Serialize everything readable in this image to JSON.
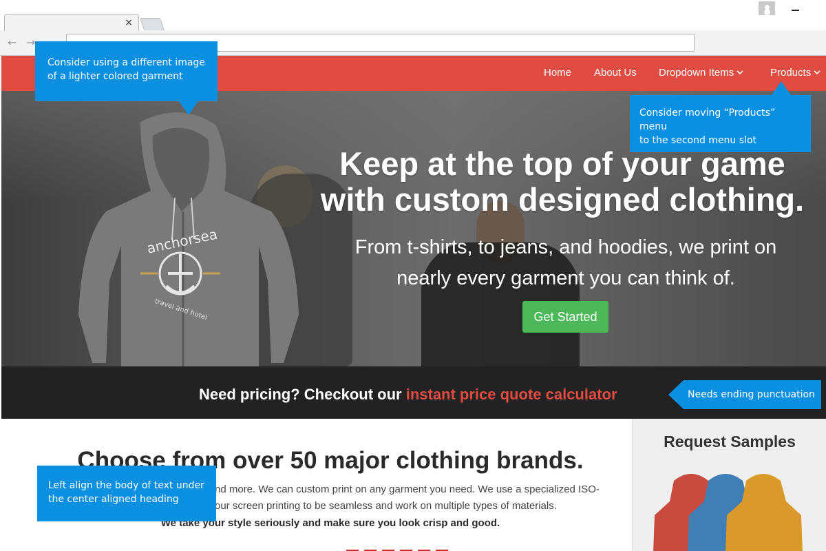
{
  "browser": {
    "tab_close": "×",
    "back_arrow": "←",
    "forward_arrow": "→",
    "icons": [
      "close-icon",
      "back-icon",
      "forward-icon",
      "user-icon",
      "minimize-icon"
    ]
  },
  "nav": {
    "items": [
      {
        "label": "Home"
      },
      {
        "label": "About Us"
      },
      {
        "label": "Dropdown Items",
        "dropdown": true
      },
      {
        "label": "Products",
        "dropdown": true
      }
    ],
    "chevron": "⌄",
    "color": "#e04b42"
  },
  "hero": {
    "title_line1": "Keep at the top of your game",
    "title_line2": "with custom designed clothing.",
    "subtitle_line1": "From t-shirts, to jeans, and hoodies, we print on",
    "subtitle_line2": "nearly every garment you can think of.",
    "cta_label": "Get Started",
    "cta_color": "#4db85a",
    "hoodie_brand": "anchorsea",
    "hoodie_tagline": "travel and hotel"
  },
  "pricing": {
    "text": "Need pricing? Checkout our ",
    "link": "instant price quote calculator",
    "background": "#222222"
  },
  "brands": {
    "heading": "Choose from over 50 major clothing brands.",
    "body": "nd more. We can custom print on any garment you need. We use a specialized ISO-",
    "body_line2": "our screen printing to be seamless and work on multiple types of materials.",
    "tagline": "We take your style seriously and make sure you look crisp and good."
  },
  "samples": {
    "heading": "Request Samples",
    "hoodie_colors": [
      "#c94a3e",
      "#3f7fb5",
      "#d99a2b"
    ]
  },
  "annotations": {
    "garment": [
      "Consider using a different image",
      "of a lighter colored garment"
    ],
    "products": [
      "Consider moving “Products” menu",
      "to the second menu slot"
    ],
    "punctuation": [
      "Needs ending punctuation"
    ],
    "alignment": [
      "Left align the body of text under",
      "the center aligned heading"
    ],
    "color": "#0b8fe0"
  }
}
